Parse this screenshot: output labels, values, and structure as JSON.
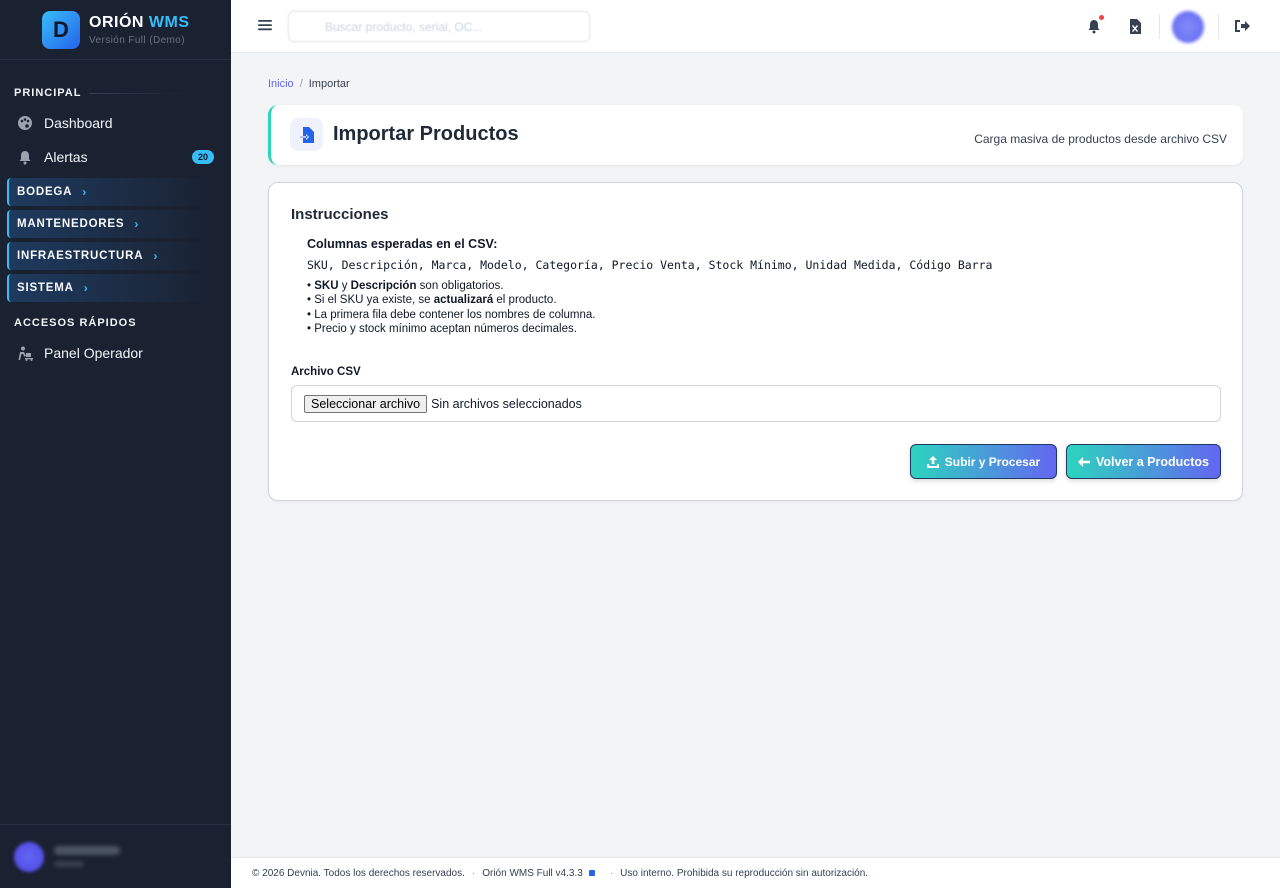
{
  "brand": {
    "logo_letter": "D",
    "title_main": "ORIÓN",
    "title_accent": "WMS",
    "subtitle": "Versión Full (Demo)"
  },
  "sidebar": {
    "section_principal": "PRINCIPAL",
    "items": [
      {
        "label": "Dashboard",
        "icon": "palette-icon"
      },
      {
        "label": "Alertas",
        "icon": "bell-icon",
        "badge": "20"
      }
    ],
    "groups": [
      {
        "label": "BODEGA"
      },
      {
        "label": "MANTENEDORES"
      },
      {
        "label": "INFRAESTRUCTURA"
      },
      {
        "label": "SISTEMA"
      }
    ],
    "section_accesos": "ACCESOS RÁPIDOS",
    "accesos": [
      {
        "label": "Panel Operador",
        "icon": "person-dolly-icon"
      }
    ]
  },
  "topbar": {
    "search_placeholder": "Buscar producto, serial, OC..."
  },
  "breadcrumb": {
    "home": "Inicio",
    "current": "Importar"
  },
  "header": {
    "title": "Importar Productos",
    "subtitle": "Carga masiva de productos desde archivo CSV"
  },
  "instructions": {
    "title": "Instrucciones",
    "columns_title": "Columnas esperadas en el CSV:",
    "columns": "SKU, Descripción, Marca, Modelo, Categoría, Precio Venta, Stock Mínimo, Unidad Medida, Código Barra",
    "note1_b1": "SKU",
    "note1_mid": " y ",
    "note1_b2": "Descripción",
    "note1_end": " son obligatorios.",
    "note2_start": "Si el SKU ya existe, se ",
    "note2_b": "actualizará",
    "note2_end": " el producto.",
    "note3": "La primera fila debe contener los nombres de columna.",
    "note4": "Precio y stock mínimo aceptan números decimales."
  },
  "upload": {
    "label": "Archivo CSV",
    "button": "Seleccionar archivo",
    "status": "Sin archivos seleccionados",
    "submit": "Subir y Procesar",
    "back": "Volver a Productos"
  },
  "footer": {
    "copyright": "© 2026 Devnia. Todos los derechos reservados.",
    "version": "Orión WMS Full v4.3.3",
    "notice": "Uso interno. Prohibida su reproducción sin autorización."
  },
  "colors": {
    "sidebar_bg": "#1a2130",
    "accent_cyan": "#38bdf8",
    "accent_teal": "#2dd4bf",
    "accent_indigo": "#6366f1"
  }
}
